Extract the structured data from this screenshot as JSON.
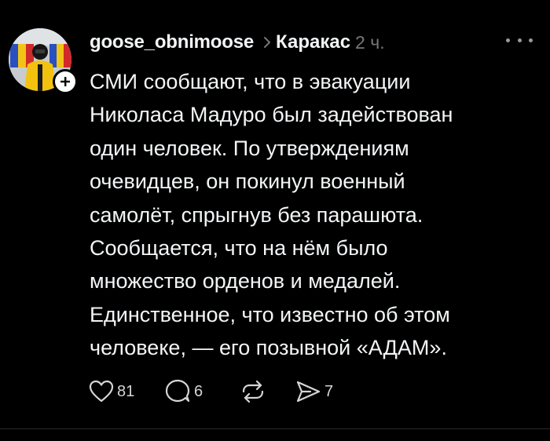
{
  "post": {
    "author": {
      "username": "goose_obnimoose",
      "avatar_icon": "profile-photo"
    },
    "topic": "Каракас",
    "timestamp": "2 ч.",
    "text": "СМИ сообщают, что в эвакуации\nНиколаса Мадуро был задействован\nодин человек. По утверждениям\nочевидцев, он покинул военный\nсамолёт, спрыгнув без парашюта.\nСообщается, что на нём было\nмножество орденов и медалей.\nЕдинственное, что известно об этом\nчеловеке, — его позывной «АДАМ».",
    "actions": {
      "likes": "81",
      "replies": "6",
      "reposts": "",
      "shares": "7"
    }
  },
  "colors": {
    "background": "#000000",
    "text_primary": "#f3f5f7",
    "text_secondary": "#777777",
    "icon": "#d5d5d5"
  }
}
